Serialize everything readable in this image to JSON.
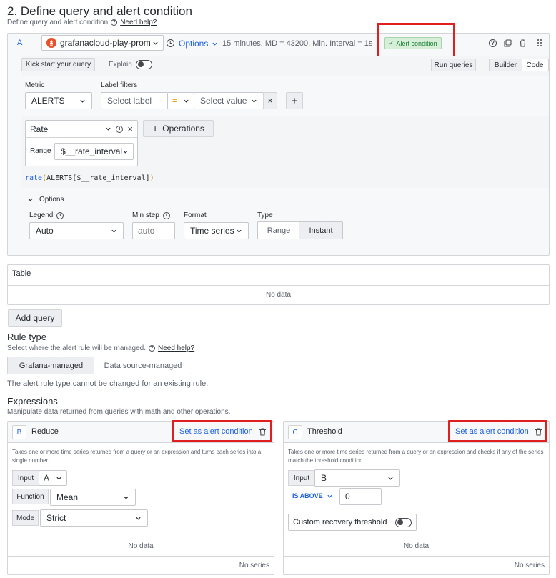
{
  "section": {
    "title": "2. Define query and alert condition",
    "subtitle": "Define query and alert condition",
    "help_link": "Need help?"
  },
  "query": {
    "ref_id": "A",
    "datasource": "grafanacloud-play-prom",
    "options_label": "Options",
    "options_summary": "15 minutes, MD = 43200, Min. Interval = 1s",
    "alert_badge": "Alert condition",
    "kick_start": "Kick start your query",
    "explain_label": "Explain",
    "run_queries": "Run queries",
    "mode_builder": "Builder",
    "mode_code": "Code",
    "metric_label": "Metric",
    "metric_value": "ALERTS",
    "label_filters_label": "Label filters",
    "select_label_placeholder": "Select label",
    "operator": "=",
    "select_value_placeholder": "Select value",
    "operation_name": "Rate",
    "range_label": "Range",
    "range_value": "$__rate_interval",
    "operations_button": "Operations",
    "expression_fn": "rate",
    "expression_args": "ALERTS[$__rate_interval]",
    "options_section": "Options",
    "legend_label": "Legend",
    "legend_value": "Auto",
    "min_step_label": "Min step",
    "min_step_placeholder": "auto",
    "format_label": "Format",
    "format_value": "Time series",
    "type_label": "Type",
    "type_range": "Range",
    "type_instant": "Instant"
  },
  "table": {
    "title": "Table",
    "empty": "No data"
  },
  "add_query": "Add query",
  "rule_type": {
    "title": "Rule type",
    "description": "Select where the alert rule will be managed.",
    "help_link": "Need help?",
    "grafana_managed": "Grafana-managed",
    "datasource_managed": "Data source-managed",
    "note": "The alert rule type cannot be changed for an existing rule."
  },
  "expressions": {
    "title": "Expressions",
    "description": "Manipulate data returned from queries with math and other operations.",
    "reduce": {
      "ref_id": "B",
      "name": "Reduce",
      "set_alert": "Set as alert condition",
      "description": "Takes one or more time series returned from a query or an expression and turns each series into a single number.",
      "input_label": "Input",
      "input_value": "A",
      "function_label": "Function",
      "function_value": "Mean",
      "mode_label": "Mode",
      "mode_value": "Strict",
      "no_data": "No data",
      "no_series": "No series"
    },
    "threshold": {
      "ref_id": "C",
      "name": "Threshold",
      "set_alert": "Set as alert condition",
      "description": "Takes one or more time series returned from a query or an expression and checks if any of the series match the threshold condition.",
      "input_label": "Input",
      "input_value": "B",
      "condition": "IS ABOVE",
      "threshold_value": "0",
      "recovery_label": "Custom recovery threshold",
      "no_data": "No data",
      "no_series": "No series"
    }
  },
  "colors": {
    "accent_blue": "#1f62e0",
    "highlight_red": "#e02020",
    "badge_green": "#1a7f37",
    "datasource_orange": "#e6522c"
  }
}
